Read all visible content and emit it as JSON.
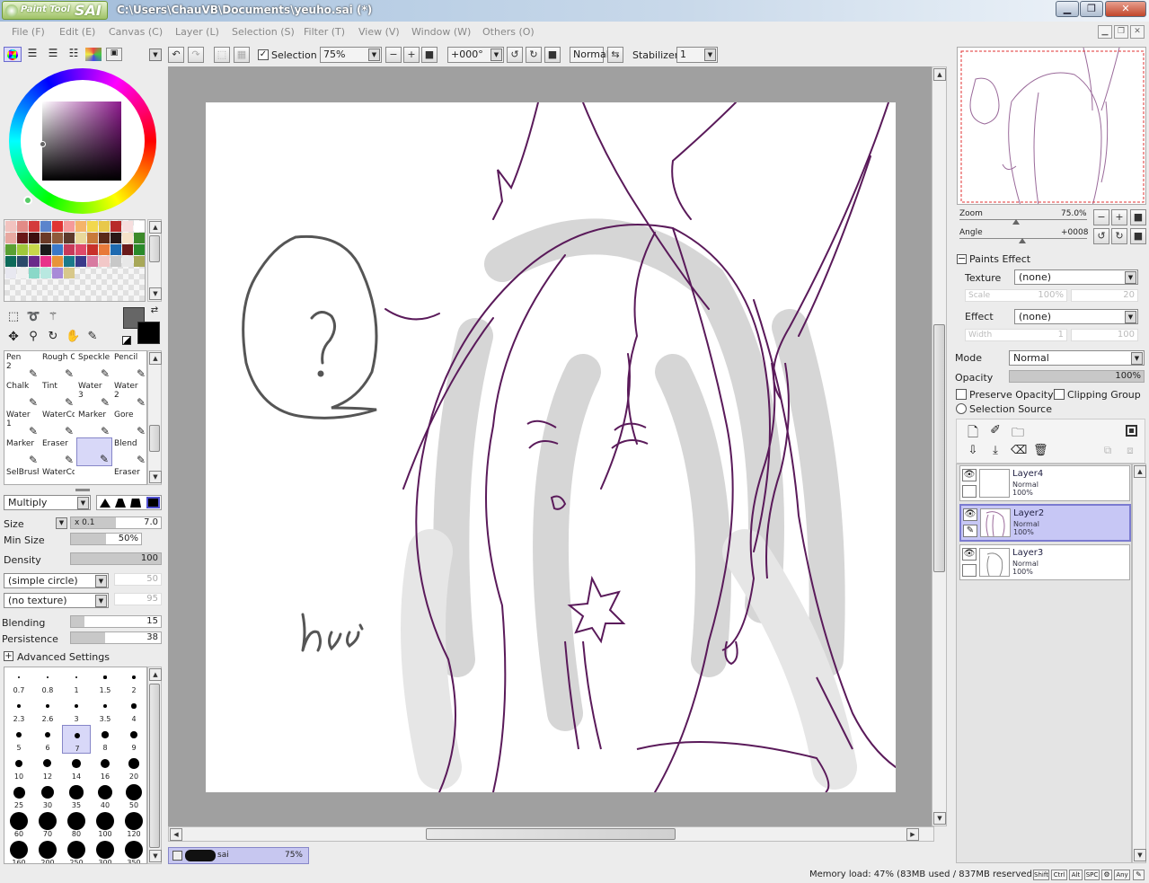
{
  "app": {
    "logo_small": "Paint Tool",
    "logo_big": "SAI",
    "title": "C:\\Users\\ChauVB\\Documents\\yeuho.sai (*)",
    "minimize": "▁",
    "maximize": "❐",
    "close": "✕"
  },
  "menu": [
    "File (F)",
    "Edit (E)",
    "Canvas (C)",
    "Layer (L)",
    "Selection (S)",
    "Filter (T)",
    "View (V)",
    "Window (W)",
    "Others (O)"
  ],
  "toolbar": {
    "selection_label": "Selection",
    "selection_checked": true,
    "zoom": "75%",
    "angle": "+000°",
    "blend_mode": "Normal",
    "stabilizer_label": "Stabilizer",
    "stabilizer_value": "1"
  },
  "colors": {
    "primary": "#666666",
    "secondary": "#000000",
    "accent_selection": "#c7c7f5",
    "line_color": "#5a1a5a"
  },
  "palette": [
    "#f2c3bf",
    "#e28b86",
    "#d43b3b",
    "#5b84cc",
    "#e03434",
    "#f59a9a",
    "#f5b46a",
    "#f2d84e",
    "#e8c84a",
    "#b82a2a",
    "#f6dede",
    "#ffffff",
    "#e8a8a0",
    "#6a1818",
    "#3c0f0f",
    "#6b3a26",
    "#8e5a3a",
    "#5c3a2c",
    "#e8d89a",
    "#c87a3a",
    "#5a2a18",
    "#2a1818",
    "#f6e2c8",
    "#3d8a2a",
    "#5aa032",
    "#9fc83a",
    "#c8d84a",
    "#1a1a1a",
    "#3a78c8",
    "#c83a5a",
    "#e04a6a",
    "#c8302a",
    "#e87a3a",
    "#1e6ab0",
    "#6a1a1a",
    "#2a8a2a",
    "#0d6a5a",
    "#2a4a6a",
    "#6a2a8a",
    "#e8328a",
    "#e8943a",
    "#1a7a8a",
    "#3a3a8a",
    "#d87aa0",
    "#f2c8c8",
    "#c8c8c8",
    "#e8e8e8",
    "#a8a858",
    "#e8e8f0",
    "#f0f0f0",
    "#8ad8c8",
    "#b8e8e0",
    "#a88ad8",
    "#d8c88a"
  ],
  "tools": [
    {
      "name": "Pen",
      "sub": "2"
    },
    {
      "name": "Rough Crayon",
      "sub": ""
    },
    {
      "name": "Speckle",
      "sub": ""
    },
    {
      "name": "Pencil",
      "sub": ""
    },
    {
      "name": "Chalk",
      "sub": ""
    },
    {
      "name": "Tint",
      "sub": ""
    },
    {
      "name": "Water",
      "sub": "3"
    },
    {
      "name": "Water",
      "sub": "2"
    },
    {
      "name": "Water",
      "sub": "1"
    },
    {
      "name": "WaterCo",
      "sub": ""
    },
    {
      "name": "Marker",
      "sub": ""
    },
    {
      "name": "Gore",
      "sub": ""
    },
    {
      "name": "Marker",
      "sub": ""
    },
    {
      "name": "Eraser",
      "sub": ""
    },
    {
      "name": "",
      "sub": ""
    },
    {
      "name": "Blend",
      "sub": ""
    },
    {
      "name": "SelBrush",
      "sub": ""
    },
    {
      "name": "WaterCo",
      "sub": ""
    },
    {
      "name": "",
      "sub": ""
    },
    {
      "name": "Eraser",
      "sub": ""
    }
  ],
  "brush": {
    "blend_mode": "Multiply",
    "size_label": "Size",
    "size_mult": "x 0.1",
    "size_value": "7.0",
    "min_size_label": "Min Size",
    "min_size_value": "50%",
    "density_label": "Density",
    "density_value": "100",
    "shape": "(simple circle)",
    "shape_value": "50",
    "texture": "(no texture)",
    "texture_value": "95",
    "blending_label": "Blending",
    "blending_value": "15",
    "persistence_label": "Persistence",
    "persistence_value": "38",
    "advanced_label": "Advanced Settings"
  },
  "brush_sizes": [
    "0.7",
    "0.8",
    "1",
    "1.5",
    "2",
    "2.3",
    "2.6",
    "3",
    "3.5",
    "4",
    "5",
    "6",
    "7",
    "8",
    "9",
    "10",
    "12",
    "14",
    "16",
    "20",
    "25",
    "30",
    "35",
    "40",
    "50",
    "60",
    "70",
    "80",
    "100",
    "120",
    "160",
    "200",
    "250",
    "300",
    "350"
  ],
  "navigator": {
    "zoom_label": "Zoom",
    "zoom_value": "75.0%",
    "angle_label": "Angle",
    "angle_value": "+0008"
  },
  "paints_effect": {
    "header": "Paints Effect",
    "texture_label": "Texture",
    "texture_value": "(none)",
    "scale_label": "Scale",
    "scale_value": "100%",
    "scale_num": "20",
    "effect_label": "Effect",
    "effect_value": "(none)",
    "width_label": "Width",
    "width_value": "1",
    "width_num": "100"
  },
  "layer_props": {
    "mode_label": "Mode",
    "mode_value": "Normal",
    "opacity_label": "Opacity",
    "opacity_value": "100%",
    "preserve_opacity": "Preserve Opacity",
    "clipping_group": "Clipping Group",
    "selection_source": "Selection Source"
  },
  "layers": [
    {
      "name": "Layer4",
      "mode": "Normal",
      "opacity": "100%",
      "selected": false
    },
    {
      "name": "Layer2",
      "mode": "Normal",
      "opacity": "100%",
      "selected": true
    },
    {
      "name": "Layer3",
      "mode": "Normal",
      "opacity": "100%",
      "selected": false
    }
  ],
  "doc_tab": {
    "name": "sai",
    "zoom": "75%"
  },
  "status": {
    "memory": "Memory load: 47% (83MB used / 837MB reserved)",
    "keys": [
      "Shift",
      "Ctrl",
      "Alt",
      "SPC",
      "Any"
    ]
  }
}
